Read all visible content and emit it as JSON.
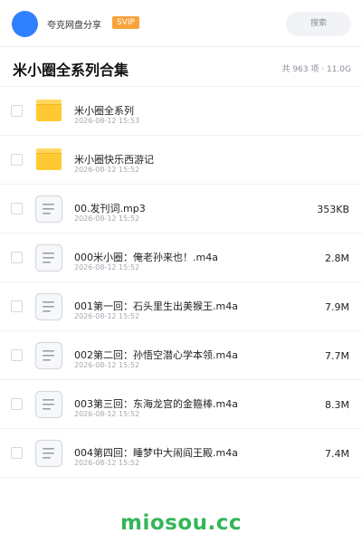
{
  "header": {
    "user_name": "夸克网盘分享",
    "badge": "SVIP",
    "search_label": "搜索"
  },
  "title_bar": {
    "title": "米小圈全系列合集",
    "summary": "共 963 项 · 11.0G"
  },
  "files": [
    {
      "type": "folder",
      "name": "米小圈全系列",
      "date": "2026-08-12 15:53",
      "size": ""
    },
    {
      "type": "folder",
      "name": "米小圈快乐西游记",
      "date": "2026-08-12 15:52",
      "size": ""
    },
    {
      "type": "file",
      "name": "00.发刊词.mp3",
      "date": "2026-08-12 15:52",
      "size": "353KB"
    },
    {
      "type": "file",
      "name": "000米小圈：俺老孙来也！.m4a",
      "date": "2026-08-12 15:52",
      "size": "2.8M"
    },
    {
      "type": "file",
      "name": "001第一回：石头里生出美猴王.m4a",
      "date": "2026-08-12 15:52",
      "size": "7.9M"
    },
    {
      "type": "file",
      "name": "002第二回：孙悟空潜心学本领.m4a",
      "date": "2026-08-12 15:52",
      "size": "7.7M"
    },
    {
      "type": "file",
      "name": "003第三回：东海龙宫的金箍棒.m4a",
      "date": "2026-08-12 15:52",
      "size": "8.3M"
    },
    {
      "type": "file",
      "name": "004第四回：睡梦中大闹阎王殿.m4a",
      "date": "2026-08-12 15:52",
      "size": "7.4M"
    }
  ],
  "colors": {
    "accent": "#2f80ff",
    "svip": "#f8a23a",
    "folder": "#ffc934",
    "watermark": "#33b657"
  },
  "icons": {
    "folder": "folder-icon",
    "file": "document-icon"
  },
  "watermark": "miosou.cc"
}
